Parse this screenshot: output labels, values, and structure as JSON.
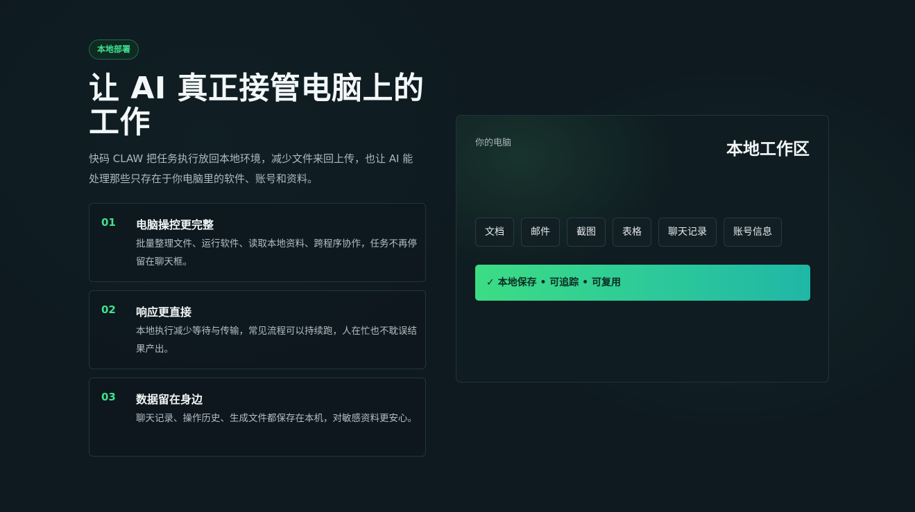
{
  "badge": "本地部署",
  "title": "让 AI 真正接管电脑上的工作",
  "description": "快码 CLAW 把任务执行放回本地环境，减少文件来回上传，也让 AI 能处理那些只存在于你电脑里的软件、账号和资料。",
  "features": [
    {
      "num": "01",
      "title": "电脑操控更完整",
      "desc": "批量整理文件、运行软件、读取本地资料、跨程序协作，任务不再停留在聊天框。"
    },
    {
      "num": "02",
      "title": "响应更直接",
      "desc": "本地执行减少等待与传输，常见流程可以持续跑，人在忙也不耽误结果产出。"
    },
    {
      "num": "03",
      "title": "数据留在身边",
      "desc": "聊天记录、操作历史、生成文件都保存在本机，对敏感资料更安心。"
    }
  ],
  "card": {
    "small_label": "你的电脑",
    "big_label": "本地工作区",
    "chips": [
      "文档",
      "邮件",
      "截图",
      "表格",
      "聊天记录",
      "账号信息"
    ],
    "status": "✓ 本地保存 • 可追踪 • 可复用"
  },
  "colors": {
    "accent": "#3ee38d",
    "background": "#0e1a20",
    "status_gradient_start": "#3ddc84",
    "status_gradient_end": "#1fb7a6"
  }
}
